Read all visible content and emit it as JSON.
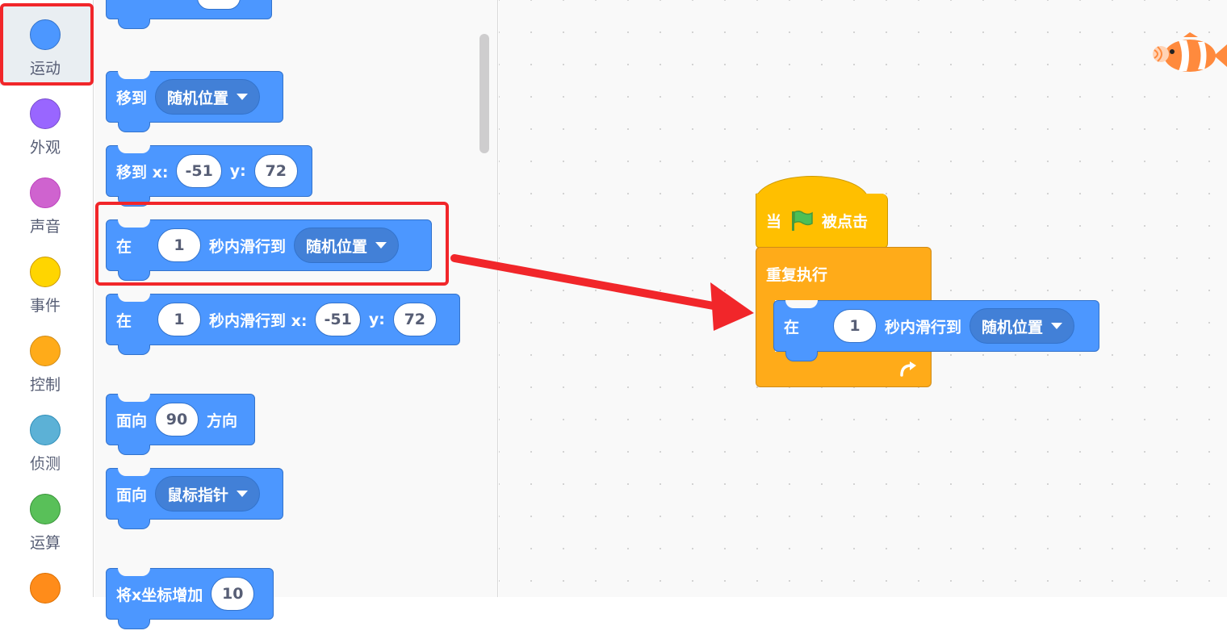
{
  "categories": [
    {
      "label": "运动",
      "color": "#4c97ff",
      "icon": "motion-dot-icon"
    },
    {
      "label": "外观",
      "color": "#9966ff",
      "icon": "looks-dot-icon"
    },
    {
      "label": "声音",
      "color": "#cf63cf",
      "icon": "sound-dot-icon"
    },
    {
      "label": "事件",
      "color": "#ffd500",
      "icon": "events-dot-icon"
    },
    {
      "label": "控制",
      "color": "#ffab19",
      "icon": "control-dot-icon"
    },
    {
      "label": "侦测",
      "color": "#5cb1d6",
      "icon": "sensing-dot-icon"
    },
    {
      "label": "运算",
      "color": "#59c059",
      "icon": "operators-dot-icon"
    },
    {
      "label": "",
      "color": "#ff8c1a",
      "icon": "variables-dot-icon"
    }
  ],
  "palette": {
    "goto": {
      "label": "移到",
      "menu": "随机位置"
    },
    "goto_xy": {
      "label": "移到 x:",
      "x": "-51",
      "ylabel": "y:",
      "y": "72"
    },
    "glide": {
      "prefix": "在",
      "secs": "1",
      "label": "秒内滑行到",
      "menu": "随机位置"
    },
    "glide_xy": {
      "prefix": "在",
      "secs": "1",
      "label": "秒内滑行到 x:",
      "x": "-51",
      "ylabel": "y:",
      "y": "72"
    },
    "point_dir": {
      "label": "面向",
      "value": "90",
      "suffix": "方向"
    },
    "point_towards": {
      "label": "面向",
      "menu": "鼠标指针"
    },
    "change_x": {
      "label": "将x坐标增加",
      "value": "10"
    }
  },
  "script": {
    "hat": {
      "prefix": "当",
      "suffix": "被点击",
      "icon": "green-flag-icon"
    },
    "forever": {
      "label": "重复执行",
      "icon": "loop-arrow-icon"
    },
    "glide": {
      "prefix": "在",
      "secs": "1",
      "label": "秒内滑行到",
      "menu": "随机位置"
    }
  },
  "colors": {
    "motion": "#4c97ff",
    "events": "#ffbf00",
    "control": "#ffab19",
    "highlight": "#f1262a"
  }
}
